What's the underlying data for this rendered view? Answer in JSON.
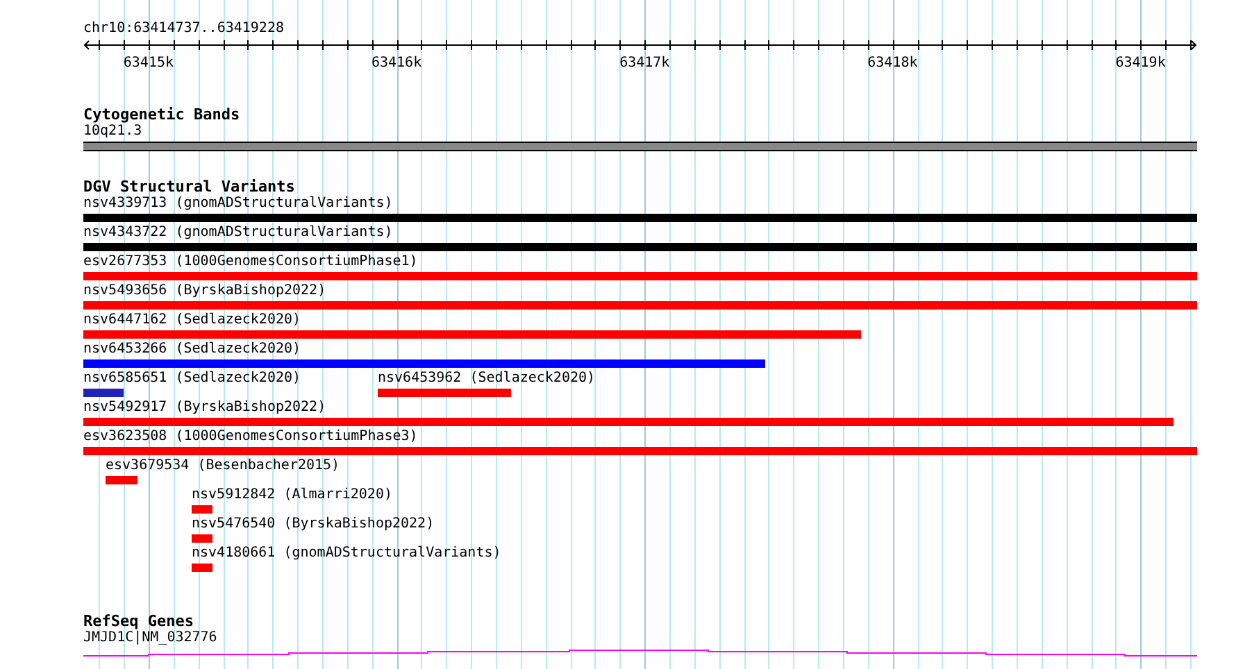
{
  "region": {
    "label": "chr10:63414737..63419228"
  },
  "ruler": {
    "ticks": [
      {
        "label": "63415k"
      },
      {
        "label": "63416k"
      },
      {
        "label": "63417k"
      },
      {
        "label": "63418k"
      },
      {
        "label": "63419k"
      }
    ]
  },
  "cytogenetic_bands": {
    "title": "Cytogenetic Bands",
    "band": "10q21.3"
  },
  "dgv_structural_variants": {
    "title": "DGV Structural Variants",
    "rows": [
      {
        "features": [
          {
            "label": "nsv4339713 (gnomADStructuralVariants)",
            "color": "#000000"
          }
        ]
      },
      {
        "features": [
          {
            "label": "nsv4343722 (gnomADStructuralVariants)",
            "color": "#000000"
          }
        ]
      },
      {
        "features": [
          {
            "label": "esv2677353 (1000GenomesConsortiumPhase1)",
            "color": "#ff0000"
          }
        ]
      },
      {
        "features": [
          {
            "label": "nsv5493656 (ByrskaBishop2022)",
            "color": "#ff0000"
          }
        ]
      },
      {
        "features": [
          {
            "label": "nsv6447162 (Sedlazeck2020)",
            "color": "#ff0000"
          }
        ]
      },
      {
        "features": [
          {
            "label": "nsv6453266 (Sedlazeck2020)",
            "color": "#0000ff"
          }
        ]
      },
      {
        "features": [
          {
            "label": "nsv6585651 (Sedlazeck2020)",
            "color": "#2222bb"
          },
          {
            "label": "nsv6453962 (Sedlazeck2020)",
            "color": "#ff0000"
          }
        ]
      },
      {
        "features": [
          {
            "label": "nsv5492917 (ByrskaBishop2022)",
            "color": "#ff0000"
          }
        ]
      },
      {
        "features": [
          {
            "label": "esv3623508 (1000GenomesConsortiumPhase3)",
            "color": "#ff0000"
          }
        ]
      },
      {
        "features": [
          {
            "label": "esv3679534 (Besenbacher2015)",
            "color": "#ff0000"
          }
        ]
      },
      {
        "features": [
          {
            "label": "nsv5912842 (Almarri2020)",
            "color": "#ff0000"
          }
        ]
      },
      {
        "features": [
          {
            "label": "nsv5476540 (ByrskaBishop2022)",
            "color": "#ff0000"
          }
        ]
      },
      {
        "features": [
          {
            "label": "nsv4180661 (gnomADStructuralVariants)",
            "color": "#ff0000"
          }
        ]
      }
    ]
  },
  "refseq_genes": {
    "title": "RefSeq Genes",
    "gene": "JMJD1C|NM_032776"
  }
}
